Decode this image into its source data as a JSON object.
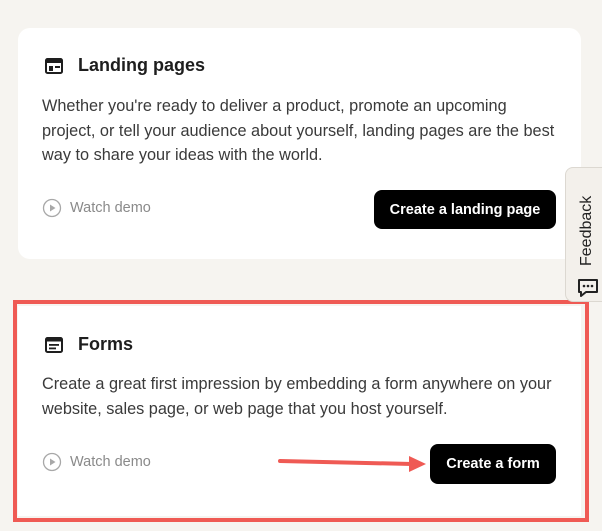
{
  "landing": {
    "title": "Landing pages",
    "icon": "layout-icon",
    "description": "Whether you're ready to deliver a product, promote an upcoming project, or tell your audience about yourself, landing pages are the best way to share your ideas with the world.",
    "watch_demo": "Watch demo",
    "cta": "Create a landing page"
  },
  "forms": {
    "title": "Forms",
    "icon": "form-icon",
    "description": "Create a great first impression by embedding a form anywhere on your website, sales page, or web page that you host yourself.",
    "watch_demo": "Watch demo",
    "cta": "Create a form"
  },
  "feedback": {
    "label": "Feedback",
    "icon": "chat-icon"
  },
  "colors": {
    "background": "#f6f4f0",
    "card": "#ffffff",
    "button": "#000000",
    "highlight": "#ef5a54",
    "muted": "#8a8a8a"
  }
}
